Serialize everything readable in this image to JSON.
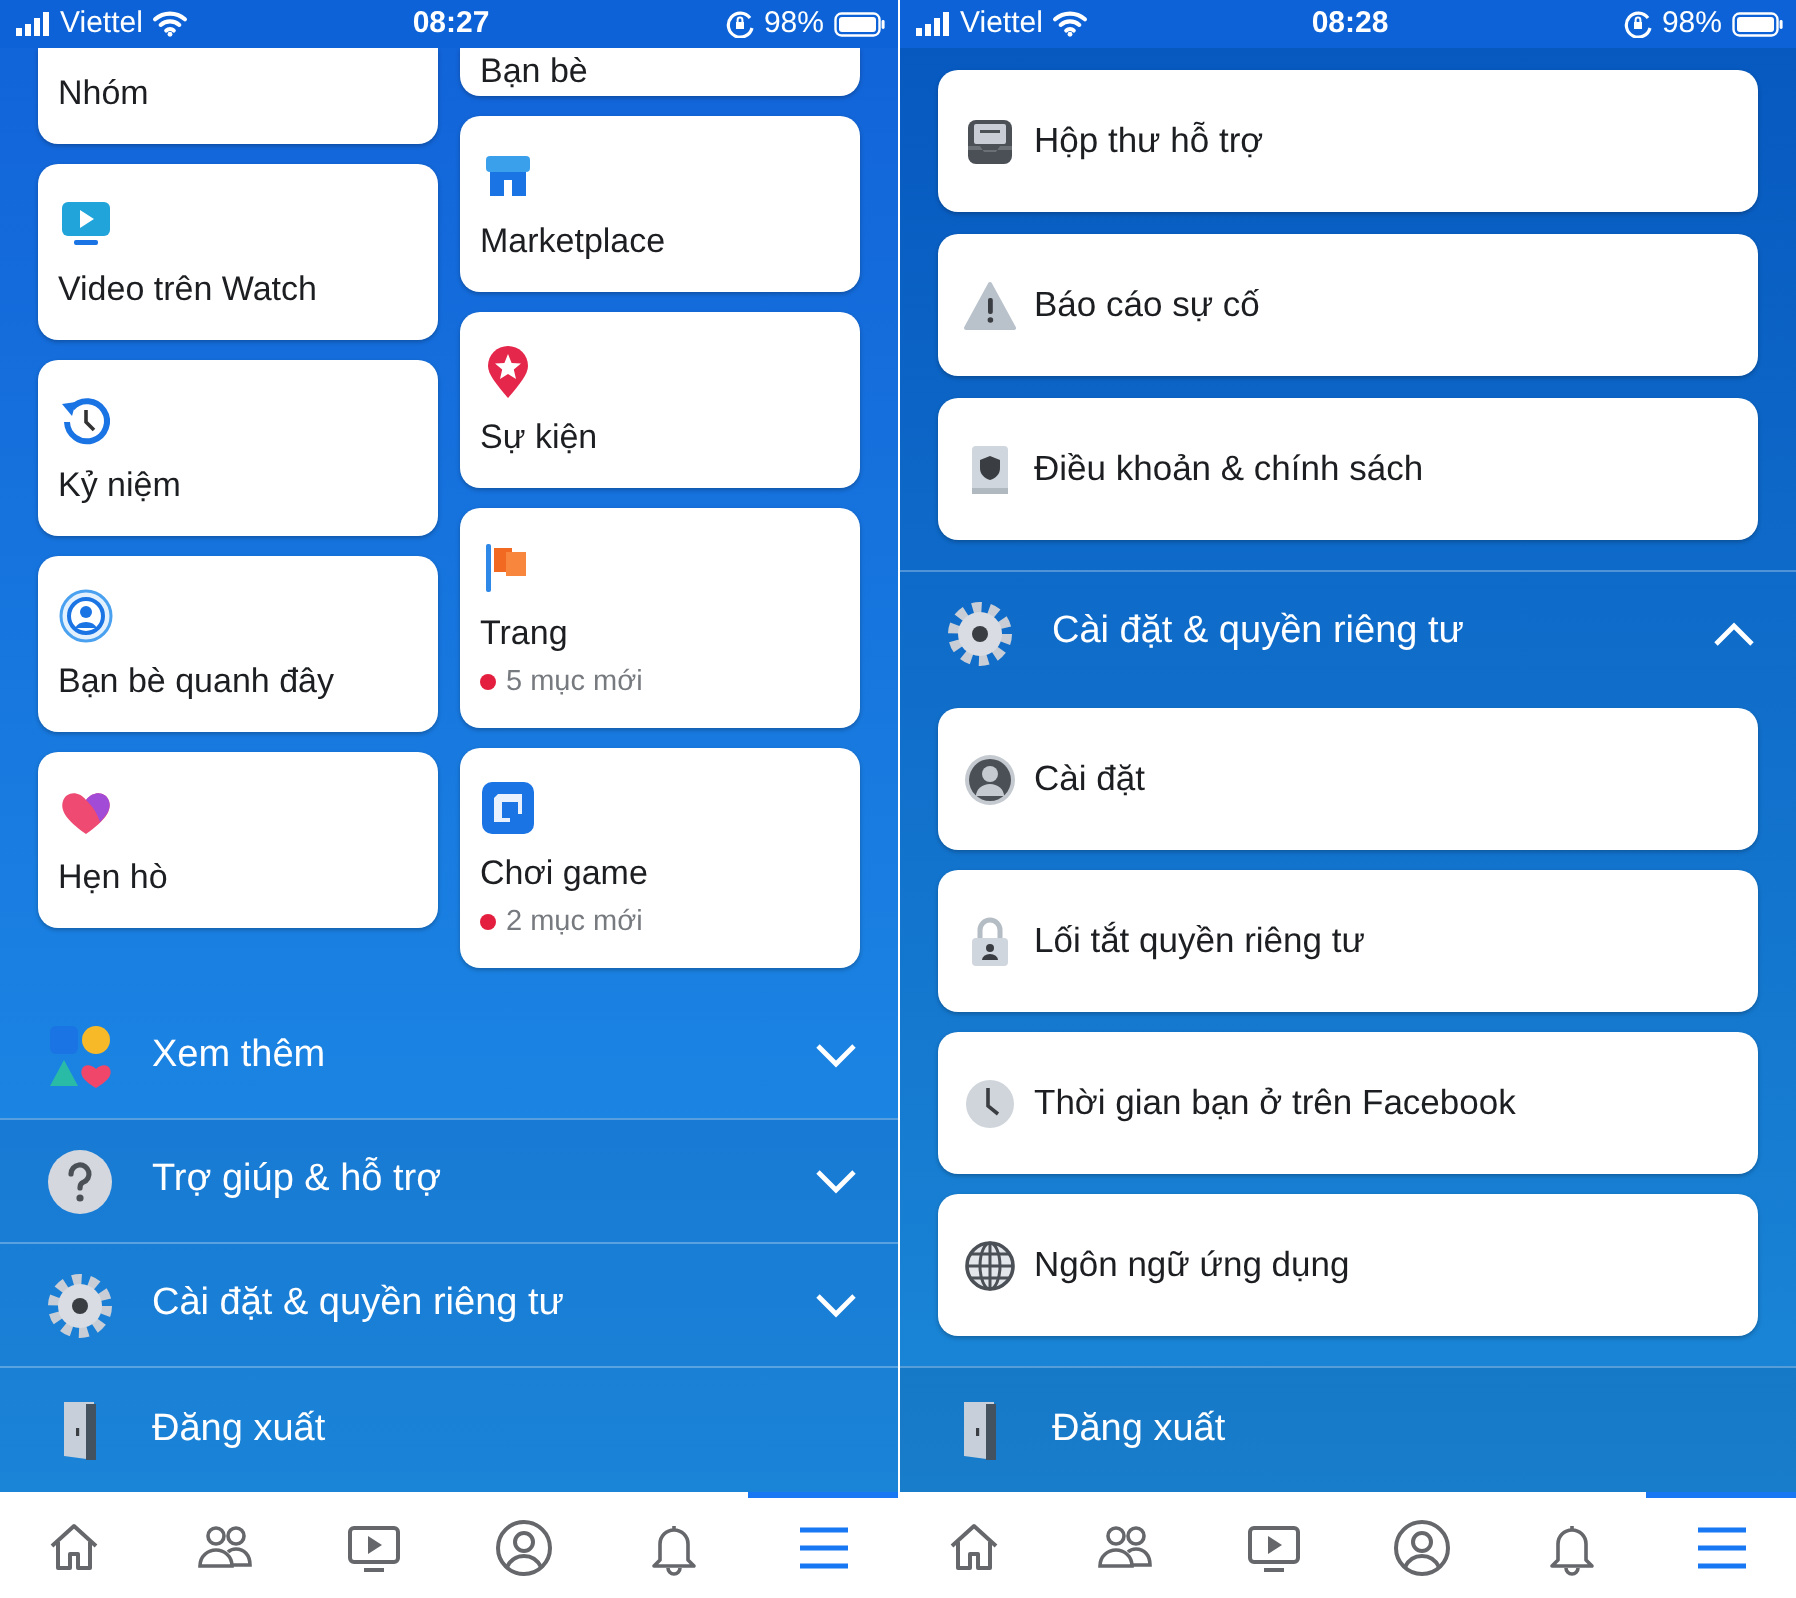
{
  "screens": [
    {
      "status_bar": {
        "carrier": "Viettel",
        "time": "08:27",
        "battery": "98%"
      },
      "shortcut_columns": [
        [
          {
            "label": "Nhóm",
            "clipped": true
          },
          {
            "label": "Video trên Watch",
            "kind": "watch",
            "clipped": false
          },
          {
            "label": "Kỷ niệm",
            "kind": "memories",
            "clipped": false
          },
          {
            "label": "Bạn bè quanh đây",
            "kind": "nearby",
            "clipped": false
          },
          {
            "label": "Hẹn hò",
            "kind": "dating",
            "clipped": false
          }
        ],
        [
          {
            "label": "Bạn bè",
            "clipped": true
          },
          {
            "label": "Marketplace",
            "kind": "marketplace",
            "clipped": false
          },
          {
            "label": "Sự kiện",
            "kind": "events",
            "clipped": false
          },
          {
            "label": "Trang",
            "kind": "pages",
            "clipped": false,
            "badge": "5 mục mới"
          },
          {
            "label": "Chơi game",
            "kind": "gaming",
            "clipped": false,
            "badge": "2 mục mới"
          }
        ]
      ],
      "sections": [
        {
          "label": "Xem thêm",
          "kind": "more",
          "expanded": false
        },
        {
          "label": "Trợ giúp & hỗ trợ",
          "kind": "help",
          "expanded": false
        },
        {
          "label": "Cài đặt & quyền riêng tư",
          "kind": "settings",
          "expanded": false
        }
      ],
      "logout": {
        "label": "Đăng xuất"
      },
      "nav": [
        {
          "kind": "home",
          "selected": false
        },
        {
          "kind": "friends",
          "selected": false
        },
        {
          "kind": "watch",
          "selected": false
        },
        {
          "kind": "profile",
          "selected": false
        },
        {
          "kind": "notifications",
          "selected": false
        },
        {
          "kind": "menu",
          "selected": true
        }
      ]
    },
    {
      "status_bar": {
        "carrier": "Viettel",
        "time": "08:28",
        "battery": "98%"
      },
      "cards": [
        {
          "label": "Hộp thư hỗ trợ",
          "kind": "inbox"
        },
        {
          "label": "Báo cáo sự cố",
          "kind": "warning"
        },
        {
          "label": "Điều khoản & chính sách",
          "kind": "policy"
        }
      ],
      "sections": [
        {
          "label": "Cài đặt & quyền riêng tư",
          "kind": "settings",
          "expanded": true,
          "items": [
            {
              "label": "Cài đặt",
              "kind": "account"
            },
            {
              "label": "Lối tắt quyền riêng tư",
              "kind": "lock"
            },
            {
              "label": "Thời gian bạn ở trên Facebook",
              "kind": "clock"
            },
            {
              "label": "Ngôn ngữ ứng dụng",
              "kind": "globe"
            }
          ]
        }
      ],
      "logout": {
        "label": "Đăng xuất"
      },
      "nav": [
        {
          "kind": "home",
          "selected": false
        },
        {
          "kind": "friends",
          "selected": false
        },
        {
          "kind": "watch",
          "selected": false
        },
        {
          "kind": "profile",
          "selected": false
        },
        {
          "kind": "notifications",
          "selected": false
        },
        {
          "kind": "menu",
          "selected": true
        }
      ]
    }
  ]
}
